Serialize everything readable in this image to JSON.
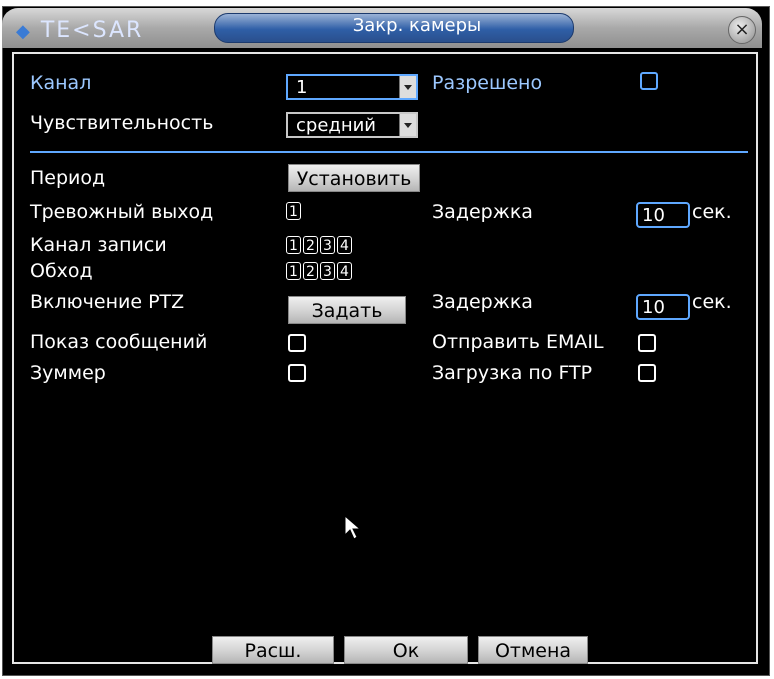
{
  "window": {
    "logo": "TE<SAR",
    "title": "Закр. камеры",
    "close_glyph": "×"
  },
  "form": {
    "channel_label": "Канал",
    "channel_value": "1",
    "enabled_label": "Разрешено",
    "sensitivity_label": "Чувствительность",
    "sensitivity_value": "средний",
    "period_label": "Период",
    "period_button": "Установить",
    "alarm_out_label": "Тревожный выход",
    "alarm_out_channels": [
      "1"
    ],
    "delay_label": "Задержка",
    "delay_value": "10",
    "delay_unit": "сек.",
    "record_channel_label": "Канал записи",
    "record_channels": [
      "1",
      "2",
      "3",
      "4"
    ],
    "tour_label": "Обход",
    "tour_channels": [
      "1",
      "2",
      "3",
      "4"
    ],
    "ptz_label": "Включение PTZ",
    "ptz_button": "Задать",
    "ptz_delay_label": "Задержка",
    "ptz_delay_value": "10",
    "ptz_delay_unit": "сек.",
    "show_message_label": "Показ сообщений",
    "send_email_label": "Отправить EMAIL",
    "buzzer_label": "Зуммер",
    "ftp_upload_label": "Загрузка по FTP"
  },
  "footer": {
    "advanced_button": "Расш.",
    "ok_button": "Ок",
    "cancel_button": "Отмена"
  },
  "colors": {
    "accent": "#5fa8ff",
    "background": "#000000",
    "text": "#ffffff"
  }
}
